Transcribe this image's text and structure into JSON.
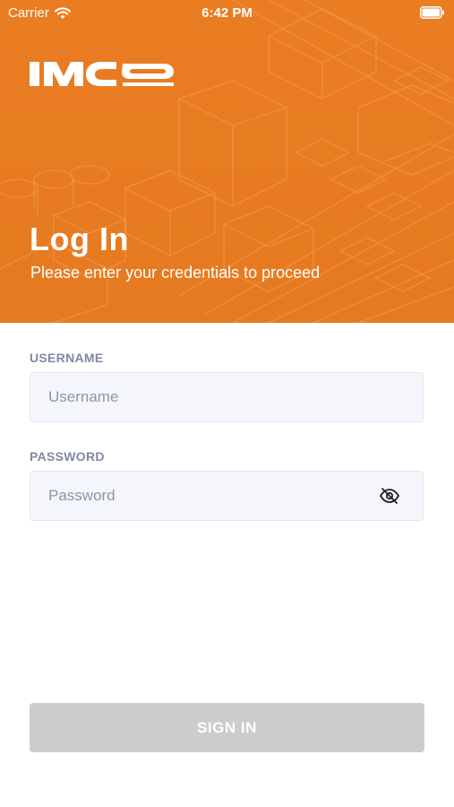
{
  "status_bar": {
    "carrier": "Carrier",
    "time": "6:42 PM",
    "wifi_icon": "wifi-icon",
    "battery_icon": "battery-icon"
  },
  "brand": {
    "logo_text": "IMCO",
    "logo_color": "#ffffff",
    "accent_color": "#e97c22"
  },
  "header": {
    "title": "Log In",
    "subtitle": "Please enter your credentials to proceed"
  },
  "form": {
    "username": {
      "label": "USERNAME",
      "placeholder": "Username",
      "value": ""
    },
    "password": {
      "label": "PASSWORD",
      "placeholder": "Password",
      "value": "",
      "toggle_icon": "eye-slash-icon"
    },
    "submit_label": "SIGN IN",
    "submit_enabled": false
  }
}
